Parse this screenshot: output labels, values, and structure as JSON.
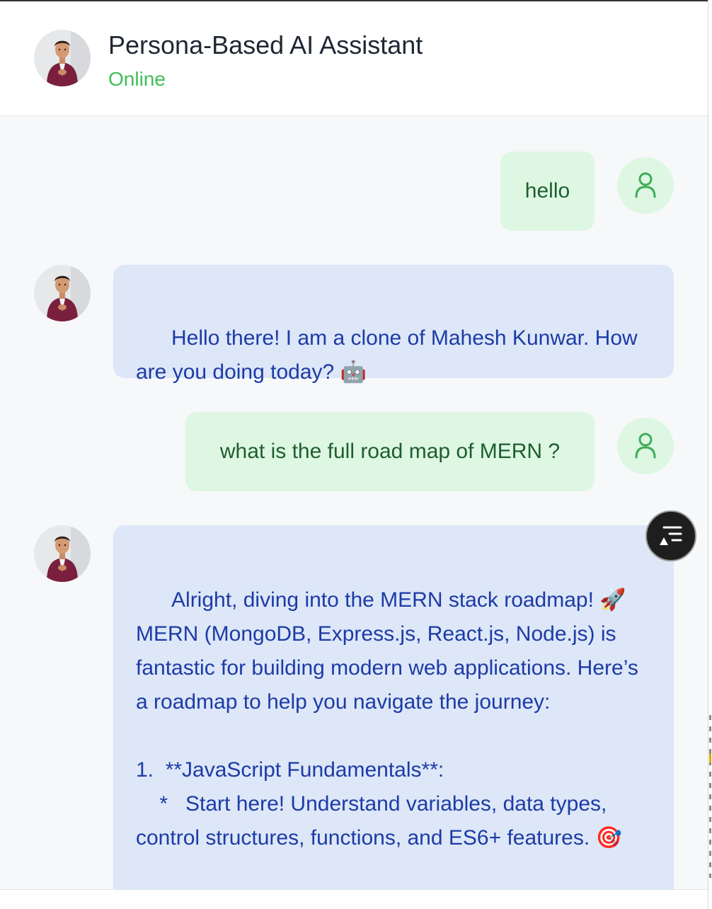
{
  "header": {
    "title": "Persona-Based AI Assistant",
    "status": "Online",
    "status_color": "#3fbe59"
  },
  "messages": [
    {
      "role": "user",
      "text": "hello"
    },
    {
      "role": "assistant",
      "text": "Hello there! I am a clone of Mahesh Kunwar. How are you doing today? 🤖"
    },
    {
      "role": "user",
      "text": "what is the full road map of MERN ?"
    },
    {
      "role": "assistant",
      "text": "Alright, diving into the MERN stack roadmap! 🚀 MERN (MongoDB, Express.js, React.js, Node.js) is fantastic for building modern web applications. Here’s a roadmap to help you navigate the journey:\n\n1.  **JavaScript Fundamentals**:\n    *   Start here! Understand variables, data types, control structures, functions, and ES6+ features. 🎯"
    }
  ],
  "colors": {
    "user_bubble": "#ddf7e3",
    "user_text": "#1f5e2e",
    "assistant_bubble": "#dde7f8",
    "assistant_text": "#1d3ba6",
    "chat_background": "#f7f8fa"
  },
  "icons": {
    "user": "user-icon",
    "floating_action": "list-icon"
  }
}
